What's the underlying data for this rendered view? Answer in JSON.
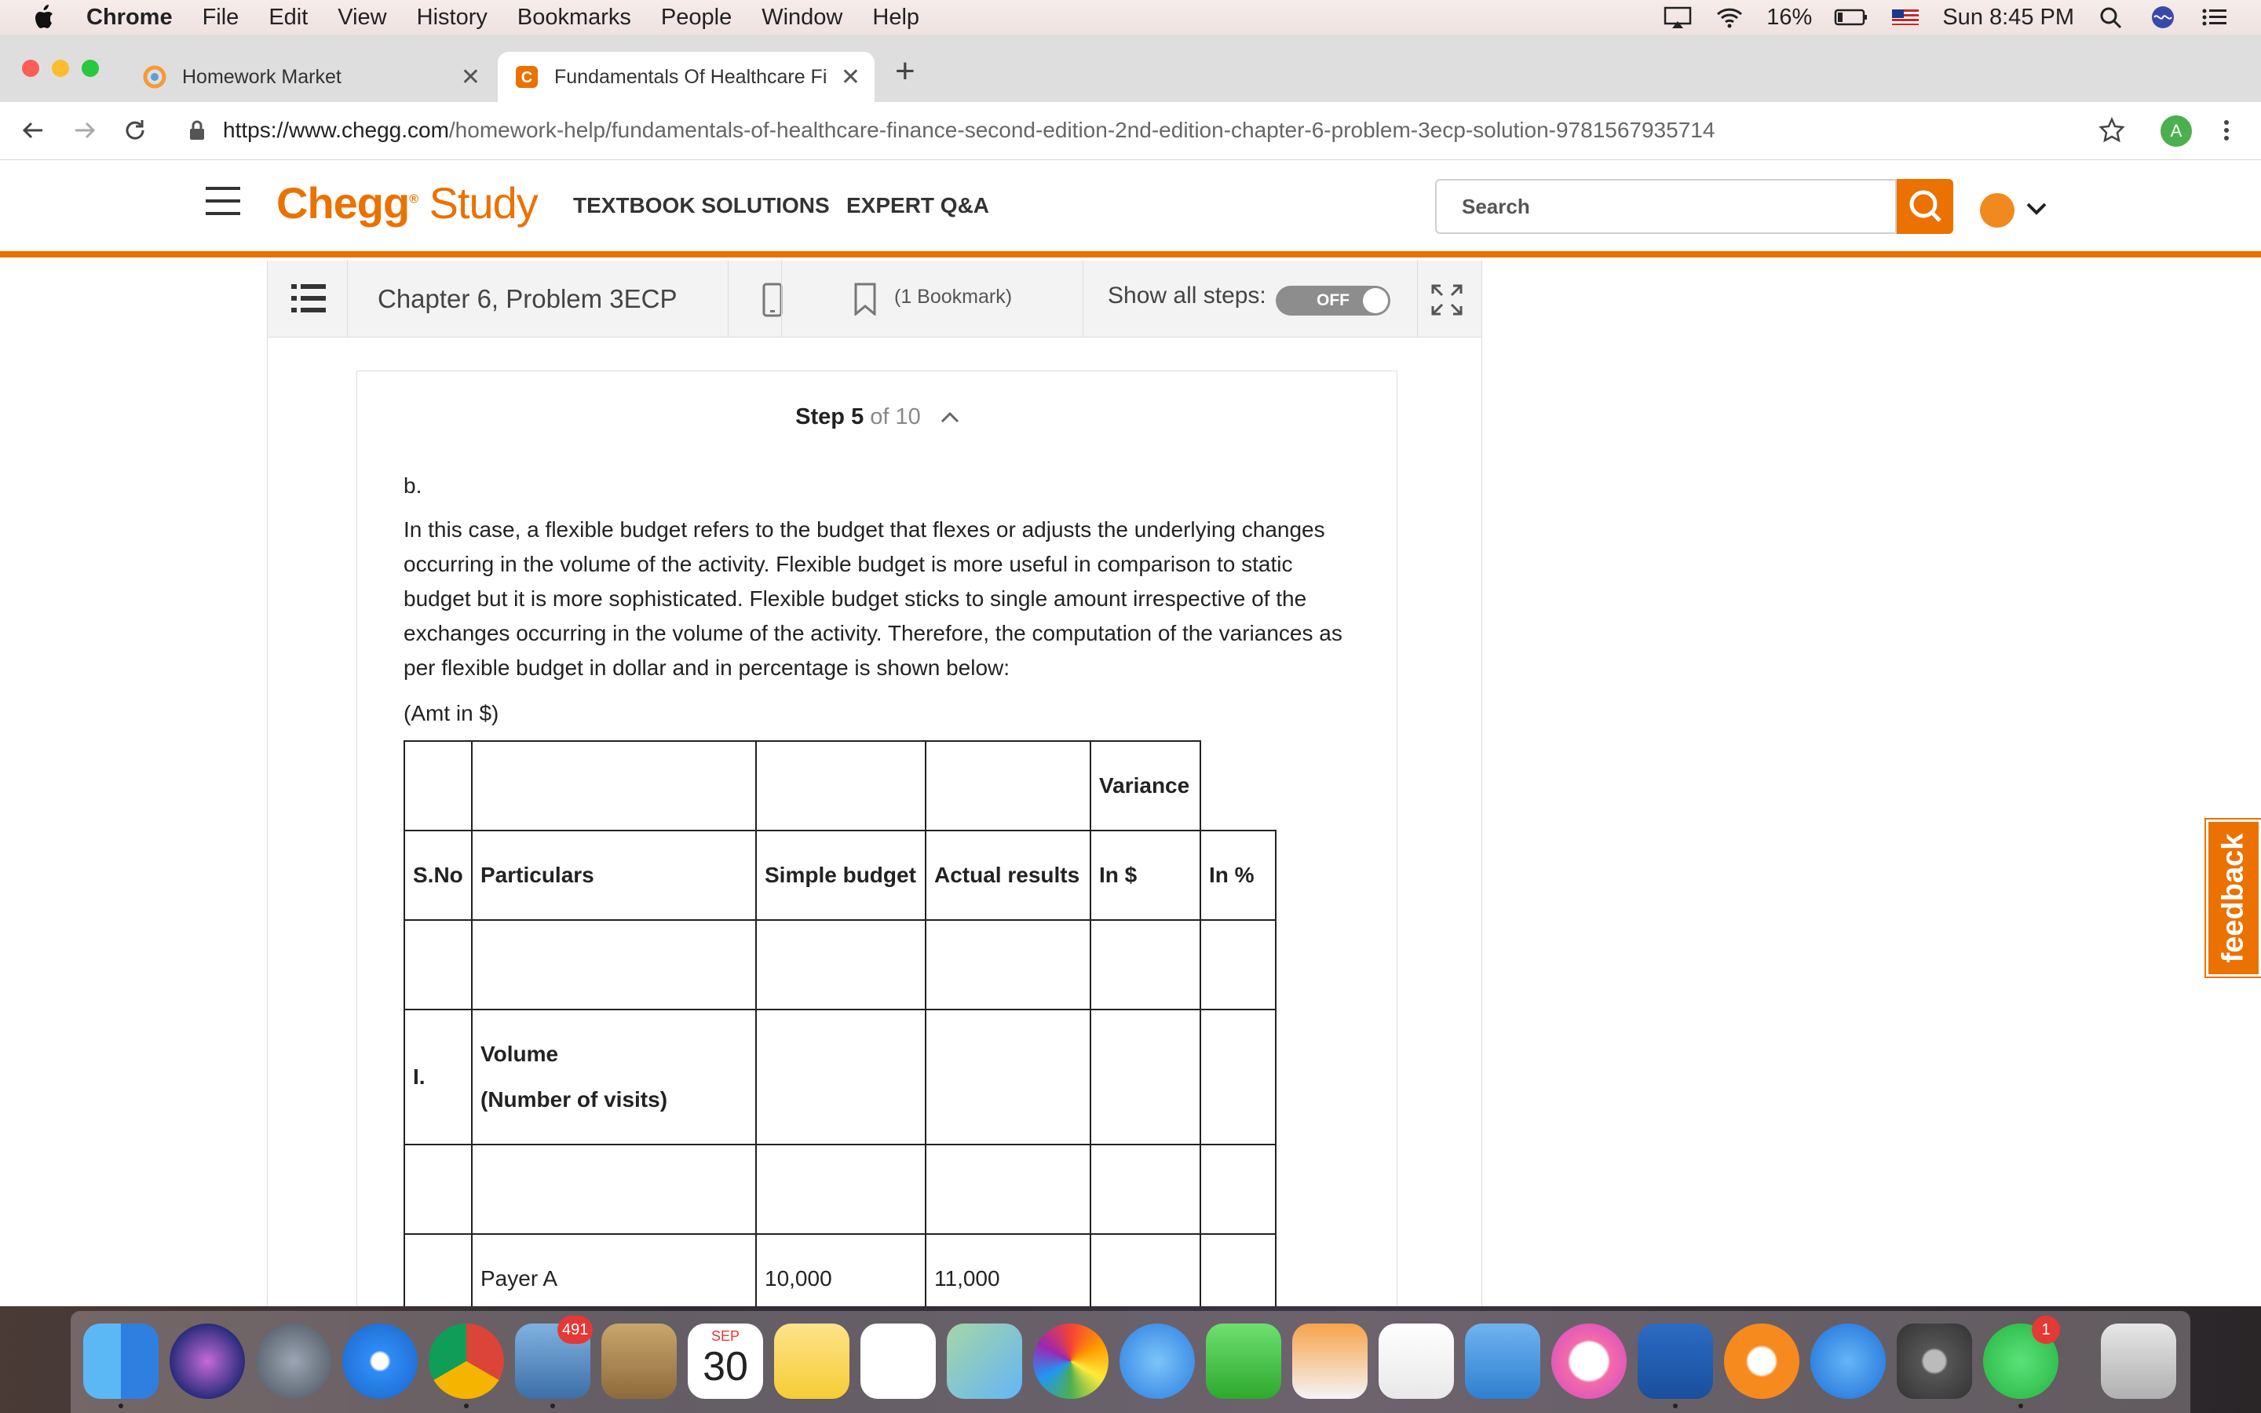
{
  "menubar": {
    "app": "Chrome",
    "items": [
      "File",
      "Edit",
      "View",
      "History",
      "Bookmarks",
      "People",
      "Window",
      "Help"
    ],
    "battery": "16%",
    "clock": "Sun 8:45 PM"
  },
  "tabs": [
    {
      "label": "Homework Market"
    },
    {
      "label": "Fundamentals Of Healthcare Fi"
    }
  ],
  "address": {
    "domain": "https://www.chegg.com",
    "path": "/homework-help/fundamentals-of-healthcare-finance-second-edition-2nd-edition-chapter-6-problem-3ecp-solution-9781567935714",
    "profile_initial": "A"
  },
  "chegg": {
    "logo_main": "Chegg",
    "logo_sub": "Study",
    "nav": [
      "TEXTBOOK SOLUTIONS",
      "EXPERT Q&A"
    ],
    "search_placeholder": "Search"
  },
  "toolbar": {
    "chapter": "Chapter 6, Problem 3ECP",
    "bookmark": "(1 Bookmark)",
    "show_all_steps": "Show all steps:",
    "toggle": "OFF"
  },
  "step": {
    "label": "Step 5",
    "of": "of 10",
    "part": "b.",
    "paragraph": "In this case, a flexible budget refers to the budget that flexes or adjusts the underlying changes occurring in the volume of the activity. Flexible budget is more useful in comparison to static budget but it is more sophisticated. Flexible budget sticks to single amount irrespective of the exchanges occurring in the volume of the activity. Therefore, the computation of the variances as per flexible budget in dollar and in percentage is shown below:",
    "amt_note": "(Amt in $)"
  },
  "table": {
    "variance_header": "Variance",
    "headers": [
      "S.No",
      "Particulars",
      "Simple budget",
      "Actual results",
      "In $",
      "In %"
    ],
    "row_volume_sno": "I.",
    "row_volume_l1": "Volume",
    "row_volume_l2": "(Number of visits)",
    "row_payer_label": "Payer A",
    "row_payer_budget": "10,000",
    "row_payer_actual": "11,000"
  },
  "feedback": "feedback",
  "dock": {
    "mail_badge": "491",
    "calendar_month": "SEP",
    "calendar_day": "30",
    "whatsapp_badge": "1"
  }
}
